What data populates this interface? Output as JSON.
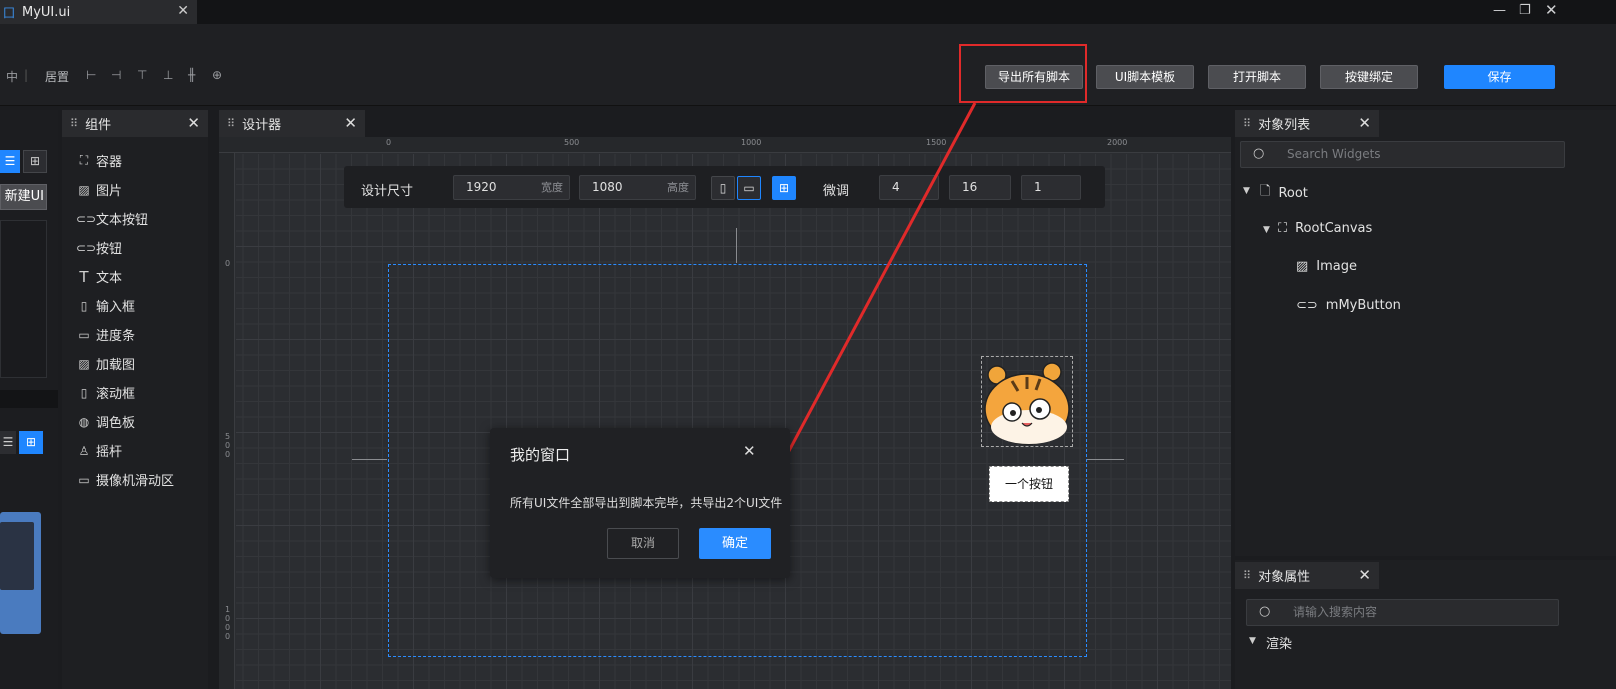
{
  "titlebar": {
    "file_tab": "MyUI.ui",
    "logo_icon": "ui-logo-icon"
  },
  "toolbar": {
    "align_label": "居置",
    "export_all_label": "导出所有脚本",
    "ui_template_label": "UI脚本模板",
    "open_script_label": "打开脚本",
    "key_binding_label": "按键绑定",
    "save_label": "保存"
  },
  "left_strip": {
    "new_ui_label": "新建UI"
  },
  "components": {
    "title": "组件",
    "items": [
      "容器",
      "图片",
      "文本按钮",
      "按钮",
      "文本",
      "输入框",
      "进度条",
      "加载图",
      "滚动框",
      "调色板",
      "摇杆",
      "摄像机滑动区"
    ]
  },
  "designer": {
    "tab": "设计器",
    "ruler_top": [
      "0",
      "500",
      "1000",
      "1500",
      "2000"
    ],
    "ruler_left": [
      "0",
      "5\n0\n0",
      "1\n0\n0\n0"
    ],
    "size_label": "设计尺寸",
    "width_value": "1920",
    "width_unit": "宽度",
    "height_value": "1080",
    "height_unit": "高度",
    "fine_tune_label": "微调",
    "fine_values": [
      "4",
      "16",
      "1"
    ],
    "widget_button_label": "一个按钮"
  },
  "dialog": {
    "title": "我的窗口",
    "message": "所有UI文件全部导出到脚本完毕，共导出2个UI文件",
    "cancel_label": "取消",
    "ok_label": "确定"
  },
  "object_list": {
    "title": "对象列表",
    "search_placeholder": "Search Widgets",
    "tree": [
      {
        "label": "Root",
        "icon": "file-icon"
      },
      {
        "label": "RootCanvas",
        "icon": "canvas-icon"
      },
      {
        "label": "Image",
        "icon": "image-icon"
      },
      {
        "label": "mMyButton",
        "icon": "toggle-icon"
      }
    ]
  },
  "properties": {
    "title": "对象属性",
    "search_placeholder": "请输入搜索内容",
    "section": "渲染"
  },
  "colors": {
    "accent": "#1f86ff",
    "annotation": "#e02a2a"
  }
}
